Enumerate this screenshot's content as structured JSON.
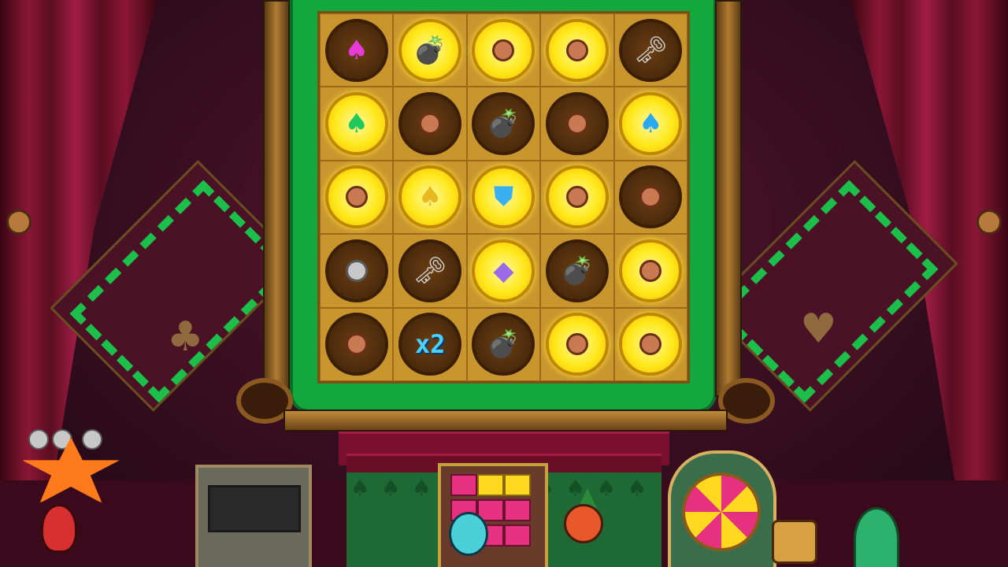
{
  "board": {
    "rows": [
      [
        {
          "state": "dark",
          "symbol": "spade",
          "color": "#e83ad8",
          "glyph": "♠"
        },
        {
          "state": "lit",
          "symbol": "grenade",
          "glyph": "💣"
        },
        {
          "state": "lit",
          "symbol": "copper-coin",
          "glyph": ""
        },
        {
          "state": "lit",
          "symbol": "copper-coin",
          "glyph": ""
        },
        {
          "state": "dark",
          "symbol": "key",
          "glyph": "🗝"
        }
      ],
      [
        {
          "state": "lit",
          "symbol": "spade",
          "color": "#1fc85a",
          "glyph": "♠"
        },
        {
          "state": "dark",
          "symbol": "copper-coin",
          "glyph": ""
        },
        {
          "state": "dark",
          "symbol": "grenade",
          "glyph": "💣"
        },
        {
          "state": "dark",
          "symbol": "copper-coin",
          "glyph": ""
        },
        {
          "state": "lit",
          "symbol": "spade",
          "color": "#2aa8f0",
          "glyph": "♠"
        }
      ],
      [
        {
          "state": "lit",
          "symbol": "copper-coin",
          "glyph": ""
        },
        {
          "state": "lit",
          "symbol": "spade",
          "color": "#e8b820",
          "glyph": "♠"
        },
        {
          "state": "lit",
          "symbol": "shield",
          "color": "#3ab0f0",
          "glyph": "⛊"
        },
        {
          "state": "lit",
          "symbol": "copper-coin",
          "glyph": ""
        },
        {
          "state": "dark",
          "symbol": "copper-coin",
          "glyph": ""
        }
      ],
      [
        {
          "state": "dark",
          "symbol": "silver-coin",
          "glyph": ""
        },
        {
          "state": "dark",
          "symbol": "key",
          "glyph": "🗝"
        },
        {
          "state": "lit",
          "symbol": "crystal",
          "color": "#9a6ae8",
          "glyph": "◆"
        },
        {
          "state": "dark",
          "symbol": "grenade",
          "glyph": "💣"
        },
        {
          "state": "lit",
          "symbol": "copper-coin",
          "glyph": ""
        }
      ],
      [
        {
          "state": "dark",
          "symbol": "copper-coin",
          "glyph": ""
        },
        {
          "state": "dark",
          "symbol": "multiplier",
          "text": "x2"
        },
        {
          "state": "dark",
          "symbol": "grenade",
          "glyph": "💣"
        },
        {
          "state": "lit",
          "symbol": "copper-coin",
          "glyph": ""
        },
        {
          "state": "lit",
          "symbol": "copper-coin",
          "glyph": ""
        }
      ]
    ]
  },
  "decor": {
    "left_suit": "♣",
    "right_suit": "♥",
    "carpet_pattern": "♠♠♠♠♠♠♠♠♠♠"
  },
  "colors": {
    "board_bg": "#c9962e",
    "frame_green": "#12a83e",
    "curtain": "#8a1636"
  }
}
